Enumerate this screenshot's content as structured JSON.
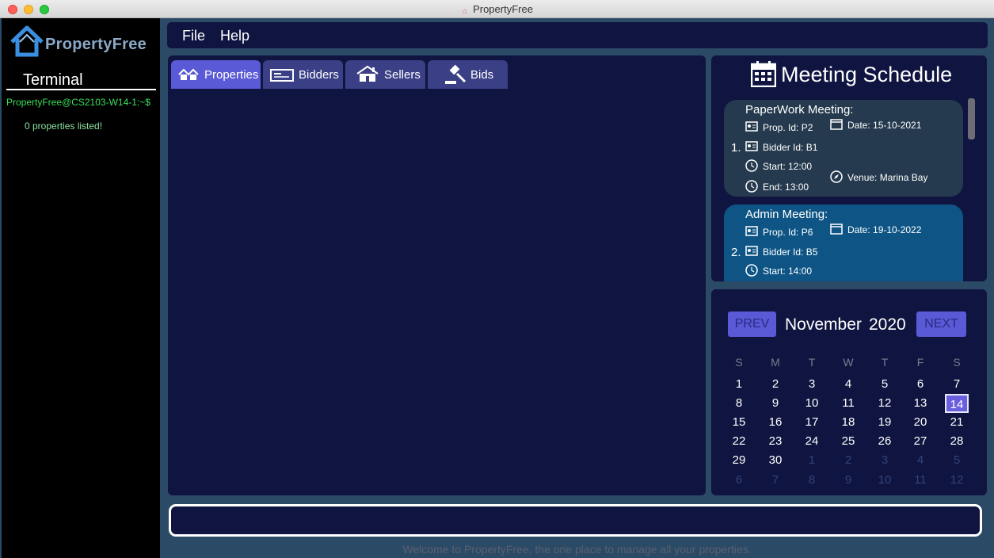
{
  "window": {
    "title": "PropertyFree"
  },
  "app": {
    "logo_text": "PropertyFree"
  },
  "terminal": {
    "title": "Terminal",
    "prompt": "PropertyFree@CS2103-W14-1:~$",
    "output": "0 properties listed!"
  },
  "menu": {
    "file": "File",
    "help": "Help"
  },
  "tabs": [
    {
      "label": "Properties",
      "icon": "houses-icon",
      "active": true
    },
    {
      "label": "Bidders",
      "icon": "id-card-icon",
      "active": false
    },
    {
      "label": "Sellers",
      "icon": "house-icon",
      "active": false
    },
    {
      "label": "Bids",
      "icon": "gavel-icon",
      "active": false
    }
  ],
  "schedule": {
    "title": "Meeting Schedule",
    "meetings": [
      {
        "index": "1.",
        "title": "PaperWork Meeting:",
        "property": "Prop. Id: P2",
        "bidder": "Bidder Id: B1",
        "start": "Start: 12:00",
        "end": "End: 13:00",
        "date": "Date: 15-10-2021",
        "venue": "Venue: Marina Bay",
        "color": "#253a4e"
      },
      {
        "index": "2.",
        "title": "Admin Meeting:",
        "property": "Prop. Id: P6",
        "bidder": "Bidder Id: B5",
        "start": "Start: 14:00",
        "date": "Date: 19-10-2022",
        "color": "#0e5585"
      }
    ]
  },
  "calendar": {
    "prev": "PREV",
    "next": "NEXT",
    "month": "November",
    "year": "2020",
    "weekdays": [
      "S",
      "M",
      "T",
      "W",
      "T",
      "F",
      "S"
    ],
    "weeks": [
      [
        "1",
        "2",
        "3",
        "4",
        "5",
        "6",
        "7"
      ],
      [
        "8",
        "9",
        "10",
        "11",
        "12",
        "13",
        "14"
      ],
      [
        "15",
        "16",
        "17",
        "18",
        "19",
        "20",
        "21"
      ],
      [
        "22",
        "23",
        "24",
        "25",
        "26",
        "27",
        "28"
      ],
      [
        "29",
        "30",
        "1",
        "2",
        "3",
        "4",
        "5"
      ],
      [
        "6",
        "7",
        "8",
        "9",
        "10",
        "11",
        "12"
      ]
    ],
    "today": "14",
    "accent": "#5a59d6"
  },
  "command": {
    "value": ""
  },
  "status": {
    "text": "Welcome to PropertyFree, the one place to manage all your properties."
  },
  "colors": {
    "panel": "#0f1540",
    "background": "#2b4a66",
    "terminal_green": "#3adf5a"
  }
}
